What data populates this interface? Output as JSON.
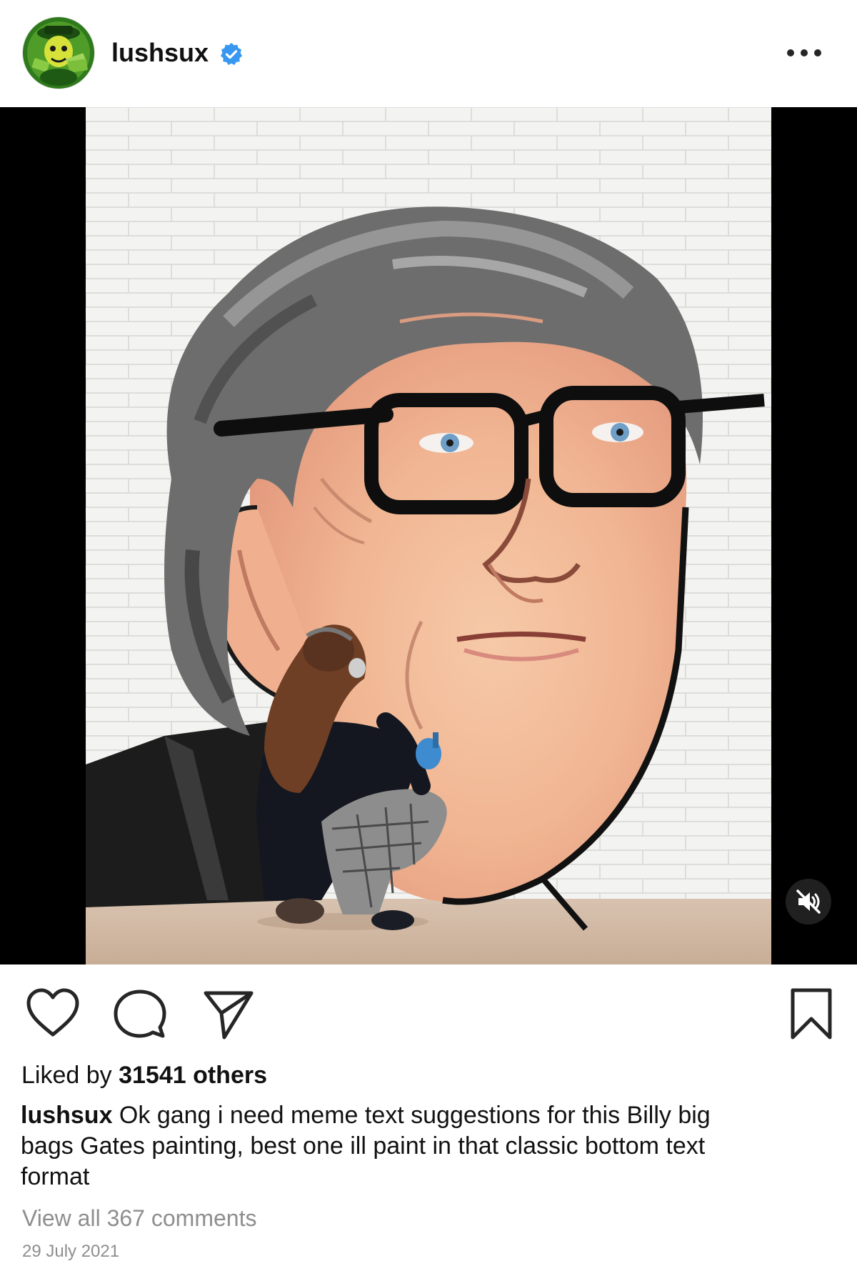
{
  "post": {
    "username": "lushsux",
    "verified": true,
    "avatar_icon": "avatar-cartoon-money-icon",
    "more_icon": "more-options-icon"
  },
  "media": {
    "type": "video",
    "description_icon": "mural-painting",
    "mute_icon": "speaker-muted-icon"
  },
  "actions": {
    "like_icon": "heart-icon",
    "comment_icon": "comment-bubble-icon",
    "share_icon": "paper-plane-icon",
    "save_icon": "bookmark-icon"
  },
  "likes": {
    "prefix": "Liked by ",
    "count_text": "31541 others"
  },
  "caption": {
    "username": "lushsux",
    "text": " Ok gang i need meme text suggestions for this Billy big bags Gates painting, best one ill paint in that classic bottom text format"
  },
  "comments": {
    "link_text": "View all 367 comments"
  },
  "date": "29 July 2021",
  "colors": {
    "verified_blue": "#3897f0",
    "secondary_text": "#8e8e8e",
    "primary_text": "#111111"
  }
}
